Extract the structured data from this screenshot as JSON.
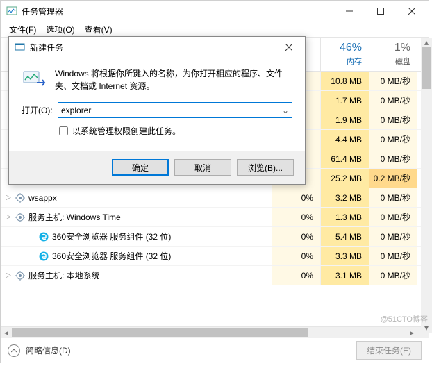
{
  "window": {
    "title": "任务管理器",
    "menus": [
      "文件(F)",
      "选项(O)",
      "查看(V)"
    ]
  },
  "headers": {
    "mem_pct": "46%",
    "mem_lbl": "内存",
    "disk_pct": "1%",
    "disk_lbl": "磁盘"
  },
  "rows": [
    {
      "name": "",
      "cpu": "",
      "mem": "10.8 MB",
      "disk": "0 MB/秒"
    },
    {
      "name": "",
      "cpu": "",
      "mem": "1.7 MB",
      "disk": "0 MB/秒"
    },
    {
      "name": "",
      "cpu": "",
      "mem": "1.9 MB",
      "disk": "0 MB/秒"
    },
    {
      "name": "",
      "cpu": "",
      "mem": "4.4 MB",
      "disk": "0 MB/秒"
    },
    {
      "name": "",
      "cpu": "",
      "mem": "61.4 MB",
      "disk": "0 MB/秒"
    },
    {
      "name": "",
      "cpu": "",
      "mem": "25.2 MB",
      "disk": "0.2 MB/秒",
      "hl": true
    },
    {
      "name": "wsappx",
      "cpu": "0%",
      "mem": "3.2 MB",
      "disk": "0 MB/秒",
      "expand": true,
      "icon": "gear"
    },
    {
      "name": "服务主机: Windows Time",
      "cpu": "0%",
      "mem": "1.3 MB",
      "disk": "0 MB/秒",
      "expand": true,
      "icon": "gear"
    },
    {
      "name": "360安全浏览器 服务组件 (32 位)",
      "cpu": "0%",
      "mem": "5.4 MB",
      "disk": "0 MB/秒",
      "indent": true,
      "icon": "e"
    },
    {
      "name": "360安全浏览器 服务组件 (32 位)",
      "cpu": "0%",
      "mem": "3.3 MB",
      "disk": "0 MB/秒",
      "indent": true,
      "icon": "e"
    },
    {
      "name": "服务主机: 本地系统",
      "cpu": "0%",
      "mem": "3.1 MB",
      "disk": "0 MB/秒",
      "expand": true,
      "icon": "gear"
    }
  ],
  "footer": {
    "brief": "简略信息(D)",
    "end_task": "结束任务(E)"
  },
  "watermark": "@51CTO博客",
  "dialog": {
    "title": "新建任务",
    "message": "Windows 将根据你所键入的名称，为你打开相应的程序、文件夹、文档或 Internet 资源。",
    "open_label": "打开(O):",
    "open_value": "explorer",
    "admin_checkbox": "以系统管理权限创建此任务。",
    "ok": "确定",
    "cancel": "取消",
    "browse": "浏览(B)..."
  }
}
